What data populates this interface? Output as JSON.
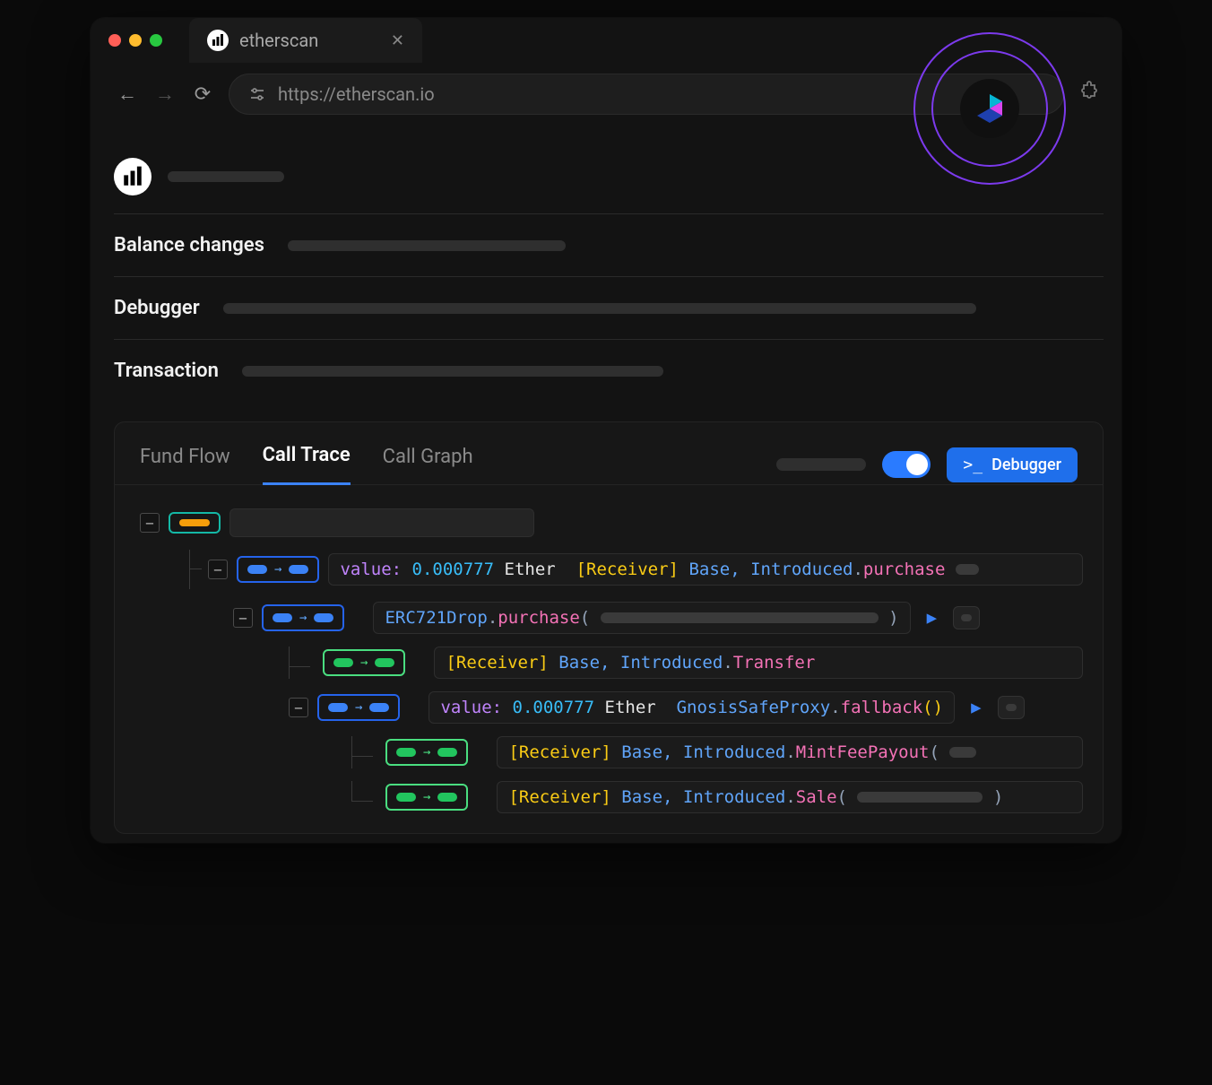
{
  "browser": {
    "tab_title": "etherscan",
    "url": "https://etherscan.io"
  },
  "sections": {
    "balance_changes": "Balance changes",
    "debugger": "Debugger",
    "transaction": "Transaction"
  },
  "panel": {
    "tabs": {
      "fund_flow": "Fund Flow",
      "call_trace": "Call Trace",
      "call_graph": "Call Graph"
    },
    "debugger_button": "Debugger"
  },
  "trace": {
    "row1": {
      "value_label": "value:",
      "amount": "0.000777",
      "currency": "Ether",
      "receiver_tag": "[Receiver]",
      "class": "Base, Introduced",
      "method": "purchase"
    },
    "row2": {
      "class": "ERC721Drop",
      "method": "purchase"
    },
    "row3": {
      "receiver_tag": "[Receiver]",
      "class": "Base, Introduced",
      "method": "Transfer"
    },
    "row4": {
      "value_label": "value:",
      "amount": "0.000777",
      "currency": "Ether",
      "class": "GnosisSafeProxy",
      "method": "fallback"
    },
    "row5": {
      "receiver_tag": "[Receiver]",
      "class": "Base, Introduced",
      "method": "MintFeePayout"
    },
    "row6": {
      "receiver_tag": "[Receiver]",
      "class": "Base, Introduced",
      "method": "Sale"
    }
  }
}
